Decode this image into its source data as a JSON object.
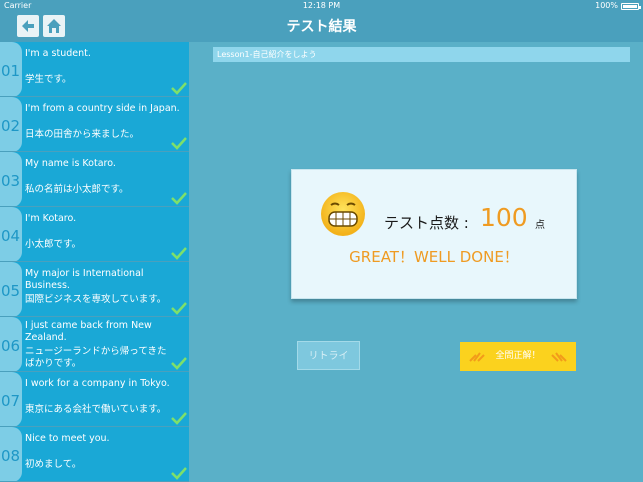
{
  "status_bar": {
    "carrier": "Carrier",
    "time": "12:18 PM",
    "battery": "100%"
  },
  "nav": {
    "title": "テスト結果",
    "back_icon": "back-arrow-icon",
    "home_icon": "home-icon"
  },
  "lesson_title": "Lesson1-自己紹介をしよう",
  "items": [
    {
      "num": "01",
      "en": "I'm a student.",
      "jp": "学生です。"
    },
    {
      "num": "02",
      "en": "I'm from a country side in Japan.",
      "jp": "日本の田舎から来ました。"
    },
    {
      "num": "03",
      "en": "My name is Kotaro.",
      "jp": "私の名前は小太郎です。"
    },
    {
      "num": "04",
      "en": "I'm Kotaro.",
      "jp": "小太郎です。"
    },
    {
      "num": "05",
      "en": "My major is International Business.",
      "jp": "国際ビジネスを専攻しています。"
    },
    {
      "num": "06",
      "en": "I just came back from New Zealand.",
      "jp": "ニュージーランドから帰ってきたばかりです。"
    },
    {
      "num": "07",
      "en": "I work for a company in Tokyo.",
      "jp": "東京にある会社で働いています。"
    },
    {
      "num": "08",
      "en": "Nice to meet you.",
      "jp": "初めまして。"
    }
  ],
  "result": {
    "score_label": "テスト点数 :",
    "score": "100",
    "unit": "点",
    "message": "GREAT！WELL DONE！"
  },
  "buttons": {
    "retry": "リトライ",
    "all_correct": "全問正解！"
  },
  "colors": {
    "accent": "#1aa8d6",
    "orange": "#ef9b22",
    "yellow": "#fbd21e"
  }
}
